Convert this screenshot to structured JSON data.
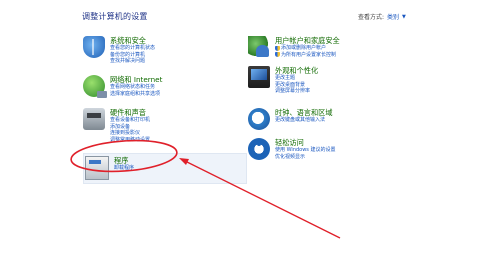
{
  "page_title": "调整计算机的设置",
  "view_mode": {
    "label": "查看方式:",
    "value": "类别"
  },
  "categories_left": [
    {
      "name": "system",
      "icon": "shield-system-icon",
      "title": "系统和安全",
      "links": [
        "查看您的计算机状态",
        "备份您的计算机",
        "查找并解决问题"
      ]
    },
    {
      "name": "network",
      "icon": "network-globe-icon",
      "title": "网络和 Internet",
      "links": [
        "查看网络状态和任务",
        "选择家庭组和共享选项"
      ]
    },
    {
      "name": "hardware",
      "icon": "printer-icon",
      "title": "硬件和声音",
      "links": [
        "查看设备和打印机",
        "添加设备",
        "连接到投影仪",
        "调整常用移动设置"
      ]
    },
    {
      "name": "programs",
      "icon": "programs-icon",
      "title": "程序",
      "links": [
        "卸载程序"
      ]
    }
  ],
  "categories_right": [
    {
      "name": "user-accounts",
      "icon": "users-icon",
      "title": "用户帐户和家庭安全",
      "links": [
        "添加或删除用户帐户",
        "为所有用户设置家长控制"
      ]
    },
    {
      "name": "appearance",
      "icon": "monitor-icon",
      "title": "外观和个性化",
      "links": [
        "更改主题",
        "更改桌面背景",
        "调整屏幕分辨率"
      ]
    },
    {
      "name": "clock",
      "icon": "clock-globe-icon",
      "title": "时钟、语言和区域",
      "links": [
        "更改键盘或其他输入法"
      ]
    },
    {
      "name": "ease-of-access",
      "icon": "ease-of-access-icon",
      "title": "轻松访问",
      "links": [
        "使用 Windows 建议的设置",
        "优化视频显示"
      ]
    }
  ],
  "shield_links": [
    "添加或删除用户帐户",
    "为所有用户设置家长控制"
  ],
  "annotation_color": "#e0202a"
}
